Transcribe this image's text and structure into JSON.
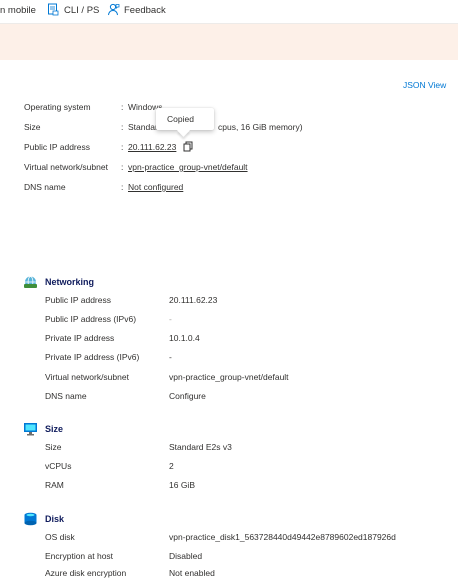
{
  "command_bar": {
    "mobile_label": "n mobile",
    "cli_label": "CLI / PS",
    "feedback_label": "Feedback"
  },
  "json_view": "JSON View",
  "essentials": {
    "os_label": "Operating system",
    "os_value": "Windows",
    "size_label": "Size",
    "size_value_left": "Standar",
    "size_value_right": "cpus, 16 GiB memory)",
    "public_ip_label": "Public IP address",
    "public_ip_value": "20.111.62.23",
    "vnet_label": "Virtual network/subnet",
    "vnet_value": "vpn-practice_group-vnet/default",
    "dns_label": "DNS name",
    "dns_value": "Not configured",
    "colon": ":"
  },
  "tooltip": "Copied",
  "networking": {
    "title": "Networking",
    "rows": [
      {
        "label": "Public IP address",
        "value": "20.111.62.23"
      },
      {
        "label": "Public IP address (IPv6)",
        "value": "-"
      },
      {
        "label": "Private IP address",
        "value": "10.1.0.4"
      },
      {
        "label": "Private IP address (IPv6)",
        "value": "-"
      },
      {
        "label": "Virtual network/subnet",
        "value": "vpn-practice_group-vnet/default"
      },
      {
        "label": "DNS name",
        "value": "Configure"
      }
    ]
  },
  "size": {
    "title": "Size",
    "rows": [
      {
        "label": "Size",
        "value": "Standard E2s v3"
      },
      {
        "label": "vCPUs",
        "value": "2"
      },
      {
        "label": "RAM",
        "value": "16 GiB"
      }
    ]
  },
  "disk": {
    "title": "Disk",
    "rows": [
      {
        "label": "OS disk",
        "value": "vpn-practice_disk1_563728440d49442e8789602ed187926d"
      },
      {
        "label": "Encryption at host",
        "value": "Disabled"
      },
      {
        "label": "Azure disk encryption",
        "value": "Not enabled"
      }
    ]
  },
  "colors": {
    "link": "#0078d4",
    "banner": "#fdf0e8",
    "section_title": "#0f1b5c"
  }
}
